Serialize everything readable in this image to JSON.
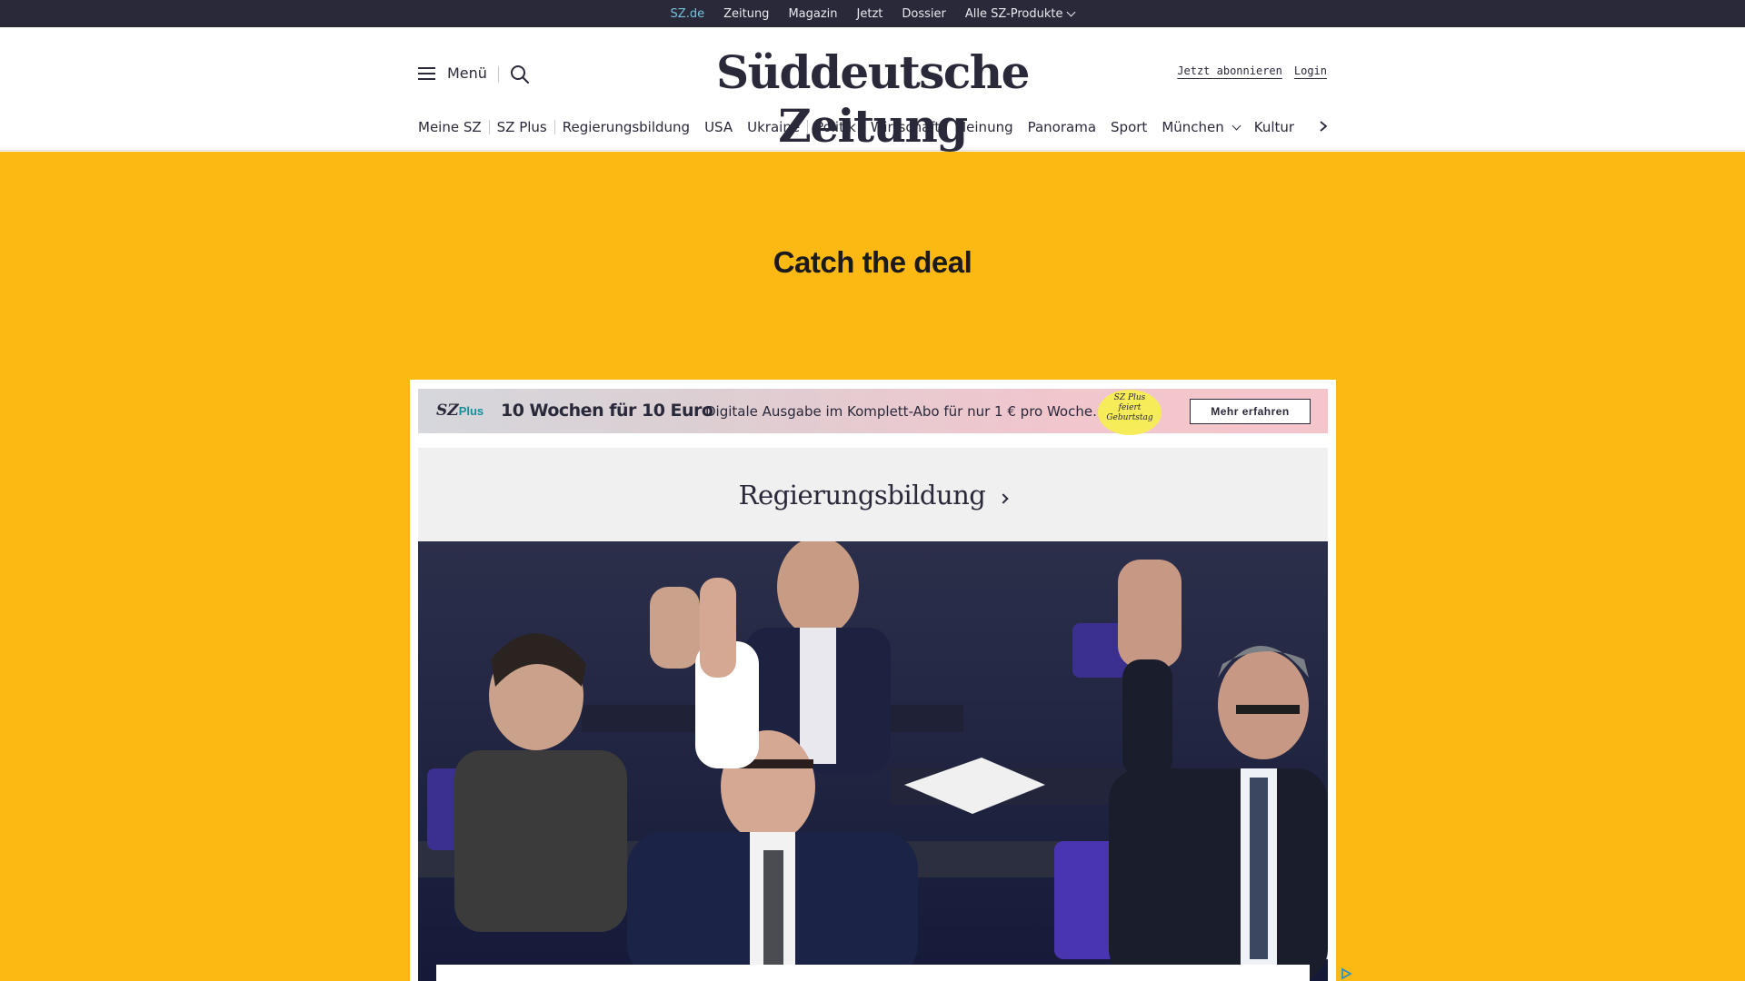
{
  "topbar": {
    "links": [
      {
        "label": "SZ.de",
        "active": true
      },
      {
        "label": "Zeitung"
      },
      {
        "label": "Magazin"
      },
      {
        "label": "Jetzt"
      },
      {
        "label": "Dossier"
      },
      {
        "label": "Alle SZ-Produkte",
        "dropdown": true
      }
    ]
  },
  "header": {
    "menu_label": "Menü",
    "logo_text": "Süddeutsche Zeitung",
    "subscribe_label": "Jetzt abonnieren",
    "login_label": "Login"
  },
  "nav": {
    "items": [
      {
        "label": "Meine SZ"
      },
      {
        "label": "SZ Plus"
      },
      {
        "label": "Regierungsbildung"
      },
      {
        "label": "USA"
      },
      {
        "label": "Ukraine"
      },
      {
        "label": "Politik"
      },
      {
        "label": "Wirtschaft"
      },
      {
        "label": "Meinung"
      },
      {
        "label": "Panorama"
      },
      {
        "label": "Sport"
      },
      {
        "label": "München"
      },
      {
        "label": "Kultur"
      }
    ]
  },
  "promo": {
    "title": "Catch the deal"
  },
  "ad": {
    "logo_sz": "SZ",
    "logo_plus": "Plus",
    "headline": "10 Wochen für 10 Euro",
    "text": "Digitale Ausgabe im Komplett-Abo für nur 1 € pro Woche.",
    "seal_line1": "SZ Plus",
    "seal_line2": "feiert",
    "seal_line3": "Geburtstag",
    "button_label": "Mehr erfahren"
  },
  "section": {
    "title": "Regierungsbildung"
  },
  "colors": {
    "topbar_bg": "#29293a",
    "topbar_active": "#79c0dc",
    "promo_bg": "#fdb913",
    "text_dark": "#29293a",
    "seal_yellow": "#f6ec5a",
    "plus_teal": "#1a8f9c"
  },
  "icons": {
    "menu": "hamburger-icon",
    "search": "search-icon",
    "nav_next": "chevron-right-icon",
    "adchoices": "adchoices-icon"
  }
}
